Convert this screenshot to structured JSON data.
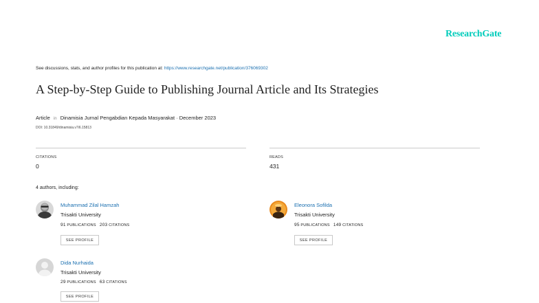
{
  "brand": "ResearchGate",
  "discussion_prefix": "See discussions, stats, and author profiles for this publication at:",
  "publication_url": "https://www.researchgate.net/publication/376069302",
  "title": "A Step-by-Step Guide to Publishing Journal Article and Its Strategies",
  "article": {
    "type": "Article",
    "in": "in",
    "venue": "Dinamisia Jurnal Pengabdian Kepada Masyarakat · December 2023",
    "doi": "DOI: 10.31849/dinamisia.v7i6.15813"
  },
  "stats": {
    "citations_label": "CITATIONS",
    "citations_value": "0",
    "reads_label": "READS",
    "reads_value": "431"
  },
  "authors_heading": "4 authors, including:",
  "authors": [
    {
      "name": "Muhammad Zilal Hamzah",
      "affiliation": "Trisakti University",
      "publications": "91",
      "citations": "203",
      "pub_label": "PUBLICATIONS",
      "cit_label": "CITATIONS",
      "button": "SEE PROFILE"
    },
    {
      "name": "Eleonora Sofilda",
      "affiliation": "Trisakti University",
      "publications": "95",
      "citations": "149",
      "pub_label": "PUBLICATIONS",
      "cit_label": "CITATIONS",
      "button": "SEE PROFILE"
    },
    {
      "name": "Dida Nurhaida",
      "affiliation": "Trisakti University",
      "publications": "29",
      "citations": "63",
      "pub_label": "PUBLICATIONS",
      "cit_label": "CITATIONS",
      "button": "SEE PROFILE"
    }
  ],
  "colors": {
    "brand": "#00ccbb",
    "link": "#1a6fb0"
  }
}
